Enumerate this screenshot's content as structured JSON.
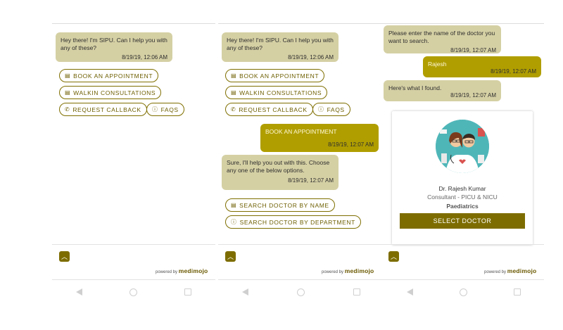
{
  "panel1": {
    "greeting": {
      "text": "Hey there! I'm SIPU. Can I help you with any of these?",
      "time": "8/19/19, 12:06 AM"
    },
    "chips": [
      {
        "label": "BOOK AN APPOINTMENT",
        "icon": "book-icon"
      },
      {
        "label": "WALKIN CONSULTATIONS",
        "icon": "book-icon"
      },
      {
        "label": "REQUEST CALLBACK",
        "icon": "phone-icon"
      },
      {
        "label": "FAQS",
        "icon": "info-icon"
      }
    ]
  },
  "panel2": {
    "greeting": {
      "text": "Hey there! I'm SIPU. Can I help you with any of these?",
      "time": "8/19/19, 12:06 AM"
    },
    "chips": [
      {
        "label": "BOOK AN APPOINTMENT",
        "icon": "book-icon"
      },
      {
        "label": "WALKIN CONSULTATIONS",
        "icon": "book-icon"
      },
      {
        "label": "REQUEST CALLBACK",
        "icon": "phone-icon"
      },
      {
        "label": "FAQS",
        "icon": "info-icon"
      }
    ],
    "user_msg": {
      "text": "BOOK AN APPOINTMENT",
      "time": "8/19/19, 12:07 AM"
    },
    "bot_reply": {
      "text": "Sure, I'll help you out with this. Choose any one of the below options.",
      "time": "8/19/19, 12:07 AM"
    },
    "options": [
      {
        "label": "SEARCH DOCTOR BY NAME",
        "icon": "book-icon"
      },
      {
        "label": "SEARCH DOCTOR BY DEPARTMENT",
        "icon": "info-icon"
      }
    ]
  },
  "panel3": {
    "prompt": {
      "text": "Please enter the name of the doctor you want to search.",
      "time": "8/19/19, 12:07 AM"
    },
    "user_msg": {
      "text": "Rajesh",
      "time": "8/19/19, 12:07 AM"
    },
    "found": {
      "text": "Here's what I found.",
      "time": "8/19/19, 12:07 AM"
    },
    "doctor": {
      "name": "Dr. Rajesh Kumar",
      "title": "Consultant - PICU & NICU",
      "department": "Paediatrics",
      "button": "SELECT DOCTOR"
    }
  },
  "footer": {
    "powered_by": "powered by",
    "brand": "medimojo"
  },
  "colors": {
    "accent": "#7d6d00",
    "user_bubble": "#b09e00",
    "bot_bubble": "#d5d0a4"
  }
}
